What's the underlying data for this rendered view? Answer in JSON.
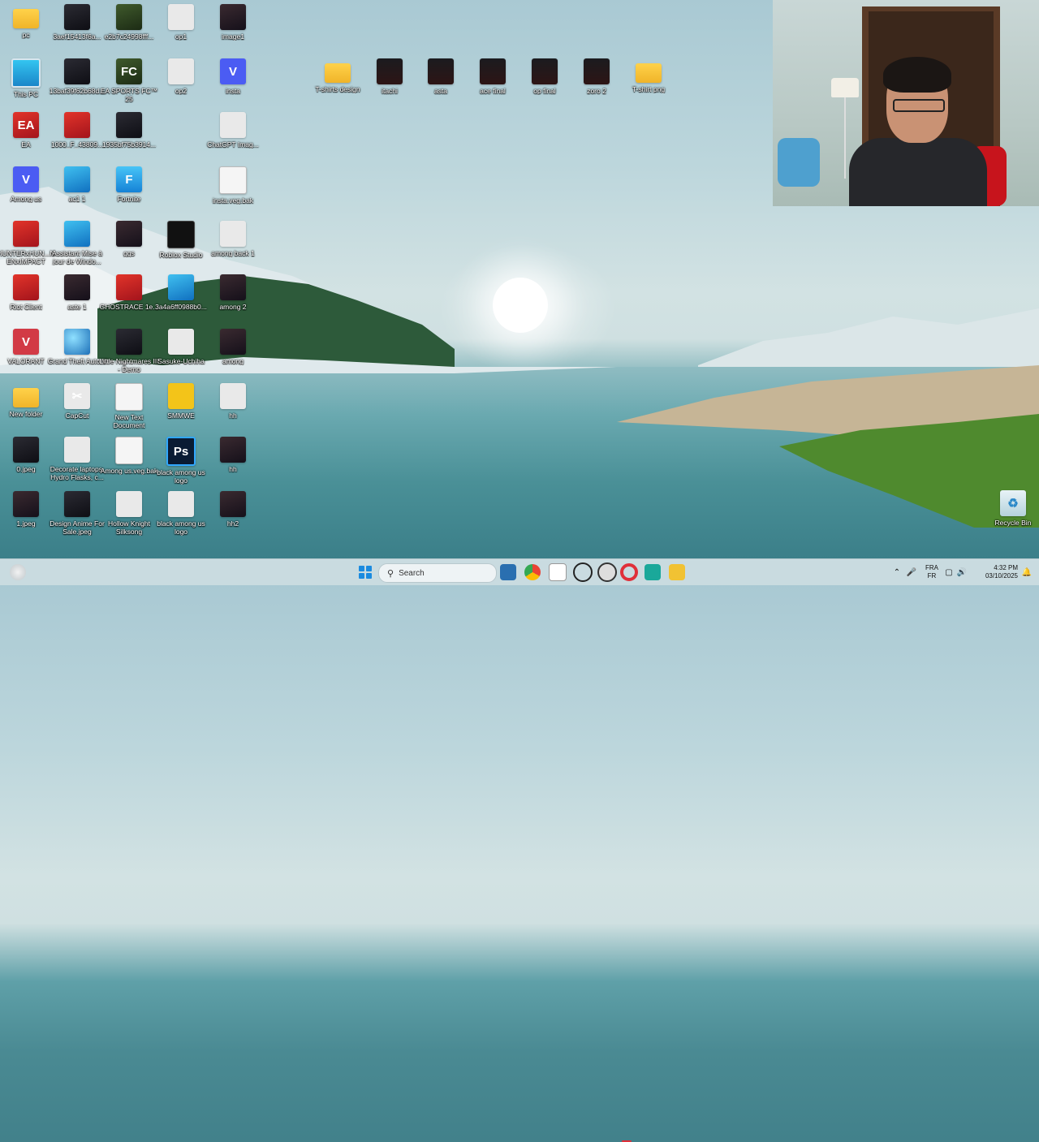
{
  "desktop": {
    "icons": [
      {
        "label": "pc",
        "glyph": "",
        "style": "g-folder"
      },
      {
        "label": "3aef15413f6a...",
        "glyph": "",
        "style": "g-dark"
      },
      {
        "label": "e2b7c24998fff...",
        "glyph": "",
        "style": "g-img2"
      },
      {
        "label": "op1",
        "glyph": "",
        "style": "g-white"
      },
      {
        "label": "image1",
        "glyph": "",
        "style": "g-img"
      },
      {
        "label": "This PC",
        "glyph": "",
        "style": "g-pc"
      },
      {
        "label": "13baf39f62b68d...",
        "glyph": "",
        "style": "g-dark"
      },
      {
        "label": "EA SPORTS FC™ 25",
        "glyph": "FC",
        "style": "g-img2"
      },
      {
        "label": "op2",
        "glyph": "",
        "style": "g-white"
      },
      {
        "label": "insta",
        "glyph": "V",
        "style": "g-v"
      },
      {
        "label": "EA",
        "glyph": "EA",
        "style": "g-red"
      },
      {
        "label": "1000_F_43809...",
        "glyph": "",
        "style": "g-red"
      },
      {
        "label": "1935bf75b3914...",
        "glyph": "",
        "style": "g-dark"
      },
      {
        "label": "ChatGPT Imag...",
        "glyph": "",
        "style": "g-white"
      },
      {
        "label": "Among us",
        "glyph": "V",
        "style": "g-v"
      },
      {
        "label": "ac1 1",
        "glyph": "",
        "style": "g-blue"
      },
      {
        "label": "Fortnite",
        "glyph": "F",
        "style": "g-f"
      },
      {
        "label": "insta.veg.bak",
        "glyph": "",
        "style": "g-doc"
      },
      {
        "label": "HUNTERxHUN...NENxIMPACT",
        "glyph": "",
        "style": "g-red"
      },
      {
        "label": "Assistant Mise à jour de Windo...",
        "glyph": "",
        "style": "g-blue"
      },
      {
        "label": "ggs",
        "glyph": "",
        "style": "g-img"
      },
      {
        "label": "Roblox Studio",
        "glyph": "",
        "style": "g-rb"
      },
      {
        "label": "among back 1",
        "glyph": "",
        "style": "g-white"
      },
      {
        "label": "Riot Client",
        "glyph": "",
        "style": "g-red"
      },
      {
        "label": "aste 1",
        "glyph": "",
        "style": "g-img"
      },
      {
        "label": "GHOSTRACE 1e...",
        "glyph": "",
        "style": "g-red"
      },
      {
        "label": "3a4a6ff0988b0...",
        "glyph": "",
        "style": "g-blue"
      },
      {
        "label": "among 2",
        "glyph": "",
        "style": "g-img"
      },
      {
        "label": "VALORANT",
        "glyph": "V",
        "style": "g-val"
      },
      {
        "label": "Grand Theft Auto V",
        "glyph": "",
        "style": "g-globe"
      },
      {
        "label": "Little Nightmares III - Demo",
        "glyph": "",
        "style": "g-dark"
      },
      {
        "label": "Sasuke-Uchiha",
        "glyph": "",
        "style": "g-white"
      },
      {
        "label": "among",
        "glyph": "",
        "style": "g-img"
      },
      {
        "label": "New folder",
        "glyph": "",
        "style": "g-folder"
      },
      {
        "label": "CapCut",
        "glyph": "✂",
        "style": "g-white"
      },
      {
        "label": "New Text Document",
        "glyph": "",
        "style": "g-doc"
      },
      {
        "label": "SMMWE",
        "glyph": "",
        "style": "g-yellow"
      },
      {
        "label": "hh",
        "glyph": "",
        "style": "g-white"
      },
      {
        "label": "0.jpeg",
        "glyph": "",
        "style": "g-dark"
      },
      {
        "label": "Decorate laptops, Hydro Flasks, c...",
        "glyph": "",
        "style": "g-white"
      },
      {
        "label": "Among us.veg.bak",
        "glyph": "",
        "style": "g-doc"
      },
      {
        "label": "black among us logo",
        "glyph": "Ps",
        "style": "g-ps"
      },
      {
        "label": "hh",
        "glyph": "",
        "style": "g-img"
      },
      {
        "label": "1.jpeg",
        "glyph": "",
        "style": "g-img"
      },
      {
        "label": "Design Anime For Sale.jpeg",
        "glyph": "",
        "style": "g-dark"
      },
      {
        "label": "Hollow Knight Silksong",
        "glyph": "",
        "style": "g-white"
      },
      {
        "label": "black among us logo",
        "glyph": "",
        "style": "g-white"
      },
      {
        "label": "hh2",
        "glyph": "",
        "style": "g-img"
      },
      {
        "label": "T-shirts design",
        "glyph": "",
        "style": "g-folder"
      },
      {
        "label": "itachi",
        "glyph": "",
        "style": "g-tee"
      },
      {
        "label": "asta",
        "glyph": "",
        "style": "g-tee"
      },
      {
        "label": "ace final",
        "glyph": "",
        "style": "g-tee"
      },
      {
        "label": "op final",
        "glyph": "",
        "style": "g-tee"
      },
      {
        "label": "zoro 2",
        "glyph": "",
        "style": "g-tee"
      },
      {
        "label": "T-shirt png",
        "glyph": "",
        "style": "g-folder"
      }
    ],
    "recycle_bin": {
      "label": "Recycle Bin"
    }
  },
  "taskbar": {
    "search_label": "Search",
    "apps": [
      "terminal",
      "chrome",
      "capture",
      "chatgpt",
      "discord",
      "opera",
      "store",
      "files"
    ],
    "tray": {
      "lang_top": "FRA",
      "lang_bottom": "FR",
      "time": "4:32 PM",
      "date": "03/10/2025"
    }
  }
}
